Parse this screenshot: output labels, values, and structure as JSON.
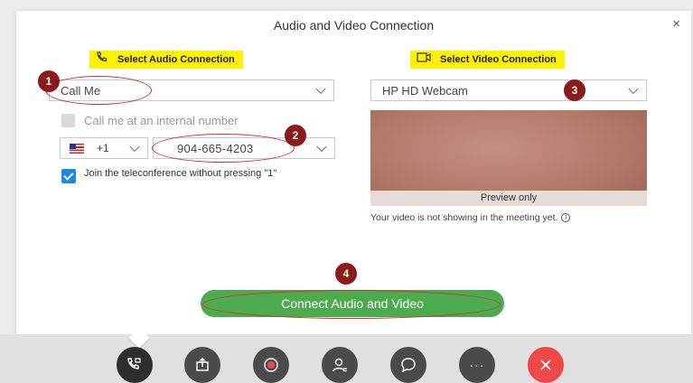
{
  "dialog": {
    "title": "Audio and Video Connection",
    "close_glyph": "×"
  },
  "audio": {
    "section_label": "Select Audio Connection",
    "section_icon": "phone-icon",
    "connection_value": "Call Me",
    "internal_label": "Call me at an internal number",
    "country_code": "+1",
    "phone_number": "904-665-4203",
    "join_label": "Join the teleconference without pressing \"1\""
  },
  "video": {
    "section_label": "Select Video Connection",
    "section_icon": "camera-icon",
    "camera_value": "HP HD Webcam",
    "preview_label": "Preview only",
    "preview_note": "Your video is not showing in the meeting yet."
  },
  "connect_button": "Connect Audio and Video",
  "markers": [
    "1",
    "2",
    "3",
    "4"
  ],
  "toolbar": {
    "buttons": [
      "audio-video-connection",
      "share",
      "record",
      "participants",
      "chat",
      "more",
      "end"
    ],
    "more_glyph": "···"
  },
  "colors": {
    "highlight": "#fff200",
    "connect_green": "#4caa4f",
    "marker": "#8b1a1a",
    "annotation_oval": "#d32f2f",
    "end_red": "#f04848",
    "checkbox_blue": "#1e88e5"
  }
}
